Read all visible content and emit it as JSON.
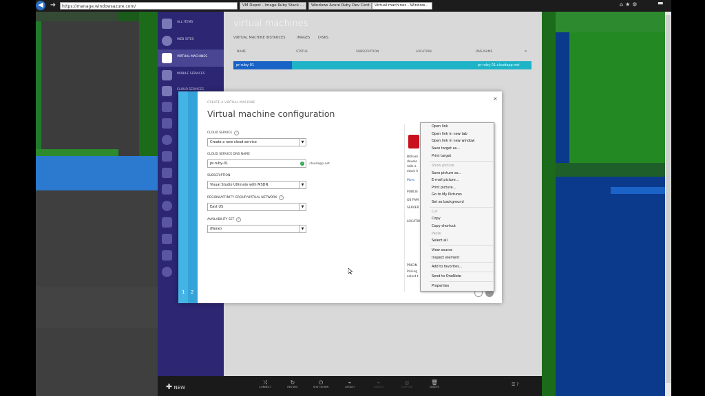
{
  "browser": {
    "address": "https://manage.windowsazure.com/",
    "tabs": [
      "VM Depot - Image Ruby Stack ...",
      "Windows Azure Ruby Dev Cent...",
      "Virtual machines - Window..."
    ],
    "close_glyph": "×",
    "icons": [
      "home-icon",
      "star-icon",
      "gear-icon"
    ]
  },
  "portal": {
    "sidebar": [
      {
        "label": "ALL ITEMS",
        "icon": "grid-icon"
      },
      {
        "label": "WEB SITES",
        "icon": "globe-icon"
      },
      {
        "label": "VIRTUAL MACHINES",
        "icon": "monitor-icon",
        "active": true
      },
      {
        "label": "MOBILE SERVICES",
        "icon": "mobile-icon"
      },
      {
        "label": "CLOUD SERVICES",
        "icon": "gear-cloud-icon"
      }
    ],
    "title": "virtual machines",
    "subtabs": [
      "VIRTUAL MACHINE INSTANCES",
      "IMAGES",
      "DISKS"
    ],
    "columns": [
      "NAME",
      "STATUS",
      "SUBSCRIPTION",
      "LOCATION",
      "DNS NAME"
    ],
    "row": {
      "name": "pr-ruby-01",
      "dns": "pr-ruby-01.cloudapp.net"
    },
    "bottom": {
      "new_label": "NEW",
      "actions": [
        "CONNECT",
        "RESTART",
        "SHUT DOWN",
        "ATTACH",
        "DETACH",
        "CAPTURE",
        "DELETE"
      ]
    }
  },
  "dialog": {
    "breadcrumb": "CREATE A VIRTUAL MACHINE",
    "title": "Virtual machine configuration",
    "close": "×",
    "steps": [
      "1",
      "2"
    ],
    "fields": {
      "cloud_service_label": "CLOUD SERVICE",
      "cloud_service_value": "Create a new cloud service",
      "dns_label": "CLOUD SERVICE DNS NAME",
      "dns_value": "pr-ruby-01",
      "dns_suffix": ".cloudapp.net",
      "subscription_label": "SUBSCRIPTION",
      "subscription_value": "Visual Studio Ultimate with MSDN",
      "region_label": "REGION/AFFINITY GROUP/VIRTUAL NETWORK",
      "region_value": "East US",
      "availability_label": "AVAILABILITY SET",
      "availability_value": "(None)"
    },
    "preview": {
      "lines": [
        "Bitham",
        "develo",
        "rails a",
        "stack h"
      ],
      "more": "More",
      "publisher": "PUBLIS",
      "os": "OS FAM",
      "servers": "SERVER",
      "location": "LOCATIO",
      "pricing_title": "PRICIN",
      "pricing_lines": [
        "Pricing",
        "select t"
      ]
    }
  },
  "context_menu": {
    "items": [
      {
        "label": "Open link",
        "enabled": true
      },
      {
        "label": "Open link in new tab",
        "enabled": true
      },
      {
        "label": "Open link in new window",
        "enabled": true
      },
      {
        "label": "Save target as...",
        "enabled": true
      },
      {
        "label": "Print target",
        "enabled": true
      },
      {
        "label": "Show picture",
        "enabled": false
      },
      {
        "label": "Save picture as...",
        "enabled": true
      },
      {
        "label": "E-mail picture...",
        "enabled": true
      },
      {
        "label": "Print picture...",
        "enabled": true
      },
      {
        "label": "Go to My Pictures",
        "enabled": true
      },
      {
        "label": "Set as background",
        "enabled": true
      },
      {
        "label": "Cut",
        "enabled": false
      },
      {
        "label": "Copy",
        "enabled": true
      },
      {
        "label": "Copy shortcut",
        "enabled": true
      },
      {
        "label": "Paste",
        "enabled": false
      },
      {
        "label": "Select all",
        "enabled": true
      },
      {
        "label": "View source",
        "enabled": true
      },
      {
        "label": "Inspect element",
        "enabled": true
      },
      {
        "label": "Add to favorites...",
        "enabled": true
      },
      {
        "label": "Send to OneNote",
        "enabled": true
      },
      {
        "label": "Properties",
        "enabled": true
      }
    ]
  },
  "colors": {
    "azure_sidebar": "#2c2673",
    "wizard_rail": "#44b4e6",
    "selected_row": "#1a63c6",
    "row_accent": "#1eb3c7",
    "check_ok": "#2ba84a"
  }
}
